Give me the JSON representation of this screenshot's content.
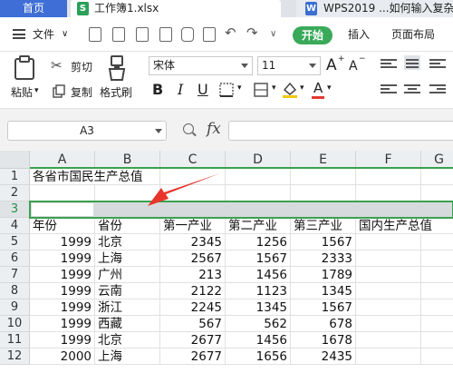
{
  "tabs": {
    "home": "首页",
    "doc1": "工作簿1.xlsx",
    "doc2": "WPS2019 ...如何输入复杂"
  },
  "menu": {
    "file": "文件",
    "start": "开始",
    "insert": "插入",
    "page_layout": "页面布局"
  },
  "ribbon": {
    "cut": "剪切",
    "copy": "复制",
    "paste": "粘贴",
    "format_painter": "格式刷",
    "font_name": "宋体",
    "font_size": "11",
    "bold": "B",
    "italic": "I",
    "underline": "U",
    "grow_font": "A",
    "shrink_font": "A",
    "font_color_glyph": "A"
  },
  "formula_bar": {
    "name_box": "A3",
    "fx": "fx",
    "formula": ""
  },
  "grid": {
    "columns": [
      "A",
      "B",
      "C",
      "D",
      "E",
      "F",
      "G"
    ],
    "row_numbers": [
      "1",
      "2",
      "3",
      "4",
      "5",
      "6",
      "7",
      "8",
      "9",
      "10",
      "11",
      "12"
    ],
    "title": "各省市国民生产总值",
    "headers": [
      "年份",
      "省份",
      "第一产业",
      "第二产业",
      "第三产业",
      "国内生产总值"
    ],
    "rows": [
      [
        "1999",
        "北京",
        "2345",
        "1256",
        "1567"
      ],
      [
        "1999",
        "上海",
        "2567",
        "1567",
        "2333"
      ],
      [
        "1999",
        "广州",
        "213",
        "1456",
        "1789"
      ],
      [
        "1999",
        "云南",
        "2122",
        "1123",
        "1345"
      ],
      [
        "1999",
        "浙江",
        "2245",
        "1345",
        "1567"
      ],
      [
        "1999",
        "西藏",
        "567",
        "562",
        "678"
      ],
      [
        "1999",
        "北京",
        "2677",
        "1456",
        "1678"
      ],
      [
        "2000",
        "上海",
        "2677",
        "1656",
        "2435"
      ]
    ]
  },
  "colors": {
    "accent_green": "#3aa14e",
    "tab_blue": "#3f6fd6",
    "arrow_red": "#e8352b"
  }
}
